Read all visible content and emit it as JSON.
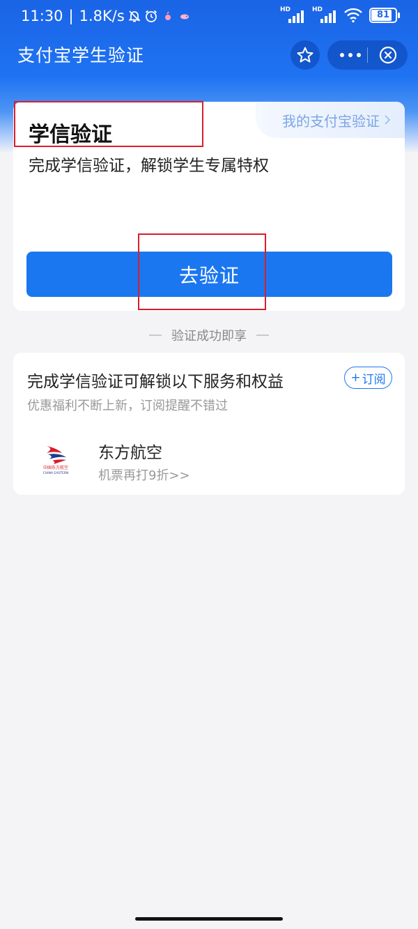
{
  "status_bar": {
    "time": "11:30",
    "net_speed": "1.8K/s",
    "signal_label_1": "HD",
    "signal_label_2": "HD",
    "battery": "81"
  },
  "nav": {
    "title": "支付宝学生验证"
  },
  "verify_card": {
    "title": "学信验证",
    "my_verify_link": "我的支付宝验证",
    "description": "完成学信验证，解锁学生专属特权",
    "button": "去验证"
  },
  "divider_label": "验证成功即享",
  "services": {
    "title": "完成学信验证可解锁以下服务和权益",
    "subtitle": "优惠福利不断上新，订阅提醒不错过",
    "subscribe_plus": "+",
    "subscribe_label": "订阅",
    "items": [
      {
        "logo_text_cn": "中国东方航空",
        "logo_text_en": "CHINA EASTERN",
        "name": "东方航空",
        "desc": "机票再打9折>>"
      }
    ]
  },
  "colors": {
    "brand_blue": "#1b77f0",
    "highlight_red": "#d81e2a"
  }
}
